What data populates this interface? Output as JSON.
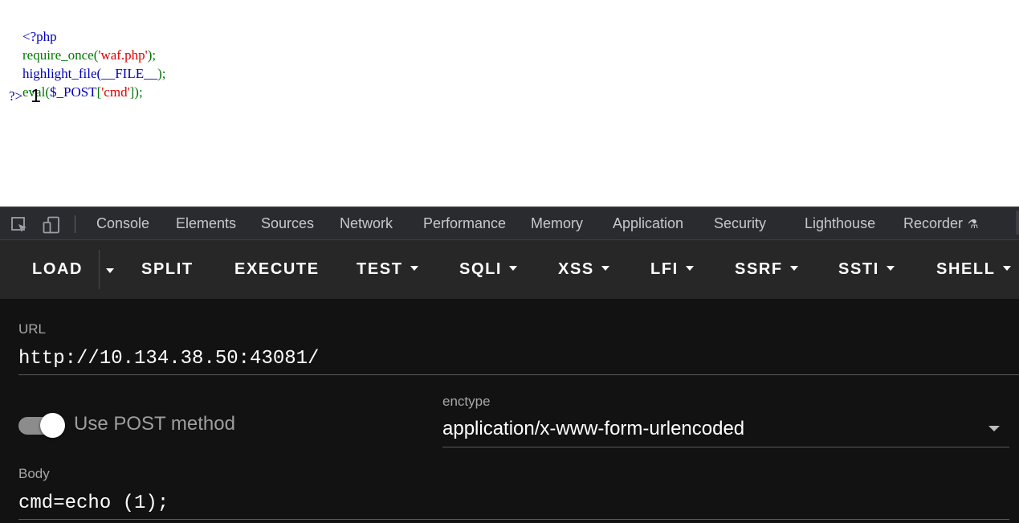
{
  "page_output": {
    "code_lines": [
      {
        "parts": [
          {
            "text": "<?php",
            "cls": "kw"
          }
        ]
      },
      {
        "parts": [
          {
            "text": "require_once(",
            "cls": "df"
          },
          {
            "text": "'waf.php'",
            "cls": "st"
          },
          {
            "text": ");",
            "cls": "df"
          }
        ]
      },
      {
        "parts": [
          {
            "text": "highlight_file(",
            "cls": "kw"
          },
          {
            "text": "__FILE__",
            "cls": "kw"
          },
          {
            "text": ");",
            "cls": "df"
          }
        ]
      },
      {
        "parts": [
          {
            "text": "eval(",
            "cls": "df"
          },
          {
            "text": "$_POST",
            "cls": "kw"
          },
          {
            "text": "[",
            "cls": "df"
          },
          {
            "text": "'cmd'",
            "cls": "st"
          },
          {
            "text": "]);",
            "cls": "df"
          }
        ]
      }
    ],
    "closing_tag": "?>",
    "echo_output": "1",
    "colors": {
      "keyword": "#0000BB",
      "default": "#007700",
      "string": "#DD0000"
    }
  },
  "devtools": {
    "tabs": [
      "Console",
      "Elements",
      "Sources",
      "Network",
      "Performance",
      "Memory",
      "Application",
      "Security",
      "Lighthouse",
      "Recorder"
    ],
    "recorder_icon": "flask-icon"
  },
  "hackbar": {
    "toolbar": {
      "load": "LOAD",
      "split": "SPLIT",
      "execute": "EXECUTE",
      "test": "TEST",
      "sqli": "SQLI",
      "xss": "XSS",
      "lfi": "LFI",
      "ssrf": "SSRF",
      "ssti": "SSTI",
      "shell": "SHELL"
    },
    "url_label": "URL",
    "url_value": "http://10.134.38.50:43081/",
    "post_toggle_label": "Use POST method",
    "post_enabled": true,
    "enctype_label": "enctype",
    "enctype_value": "application/x-www-form-urlencoded",
    "body_label": "Body",
    "body_value": "cmd=echo (1);"
  }
}
